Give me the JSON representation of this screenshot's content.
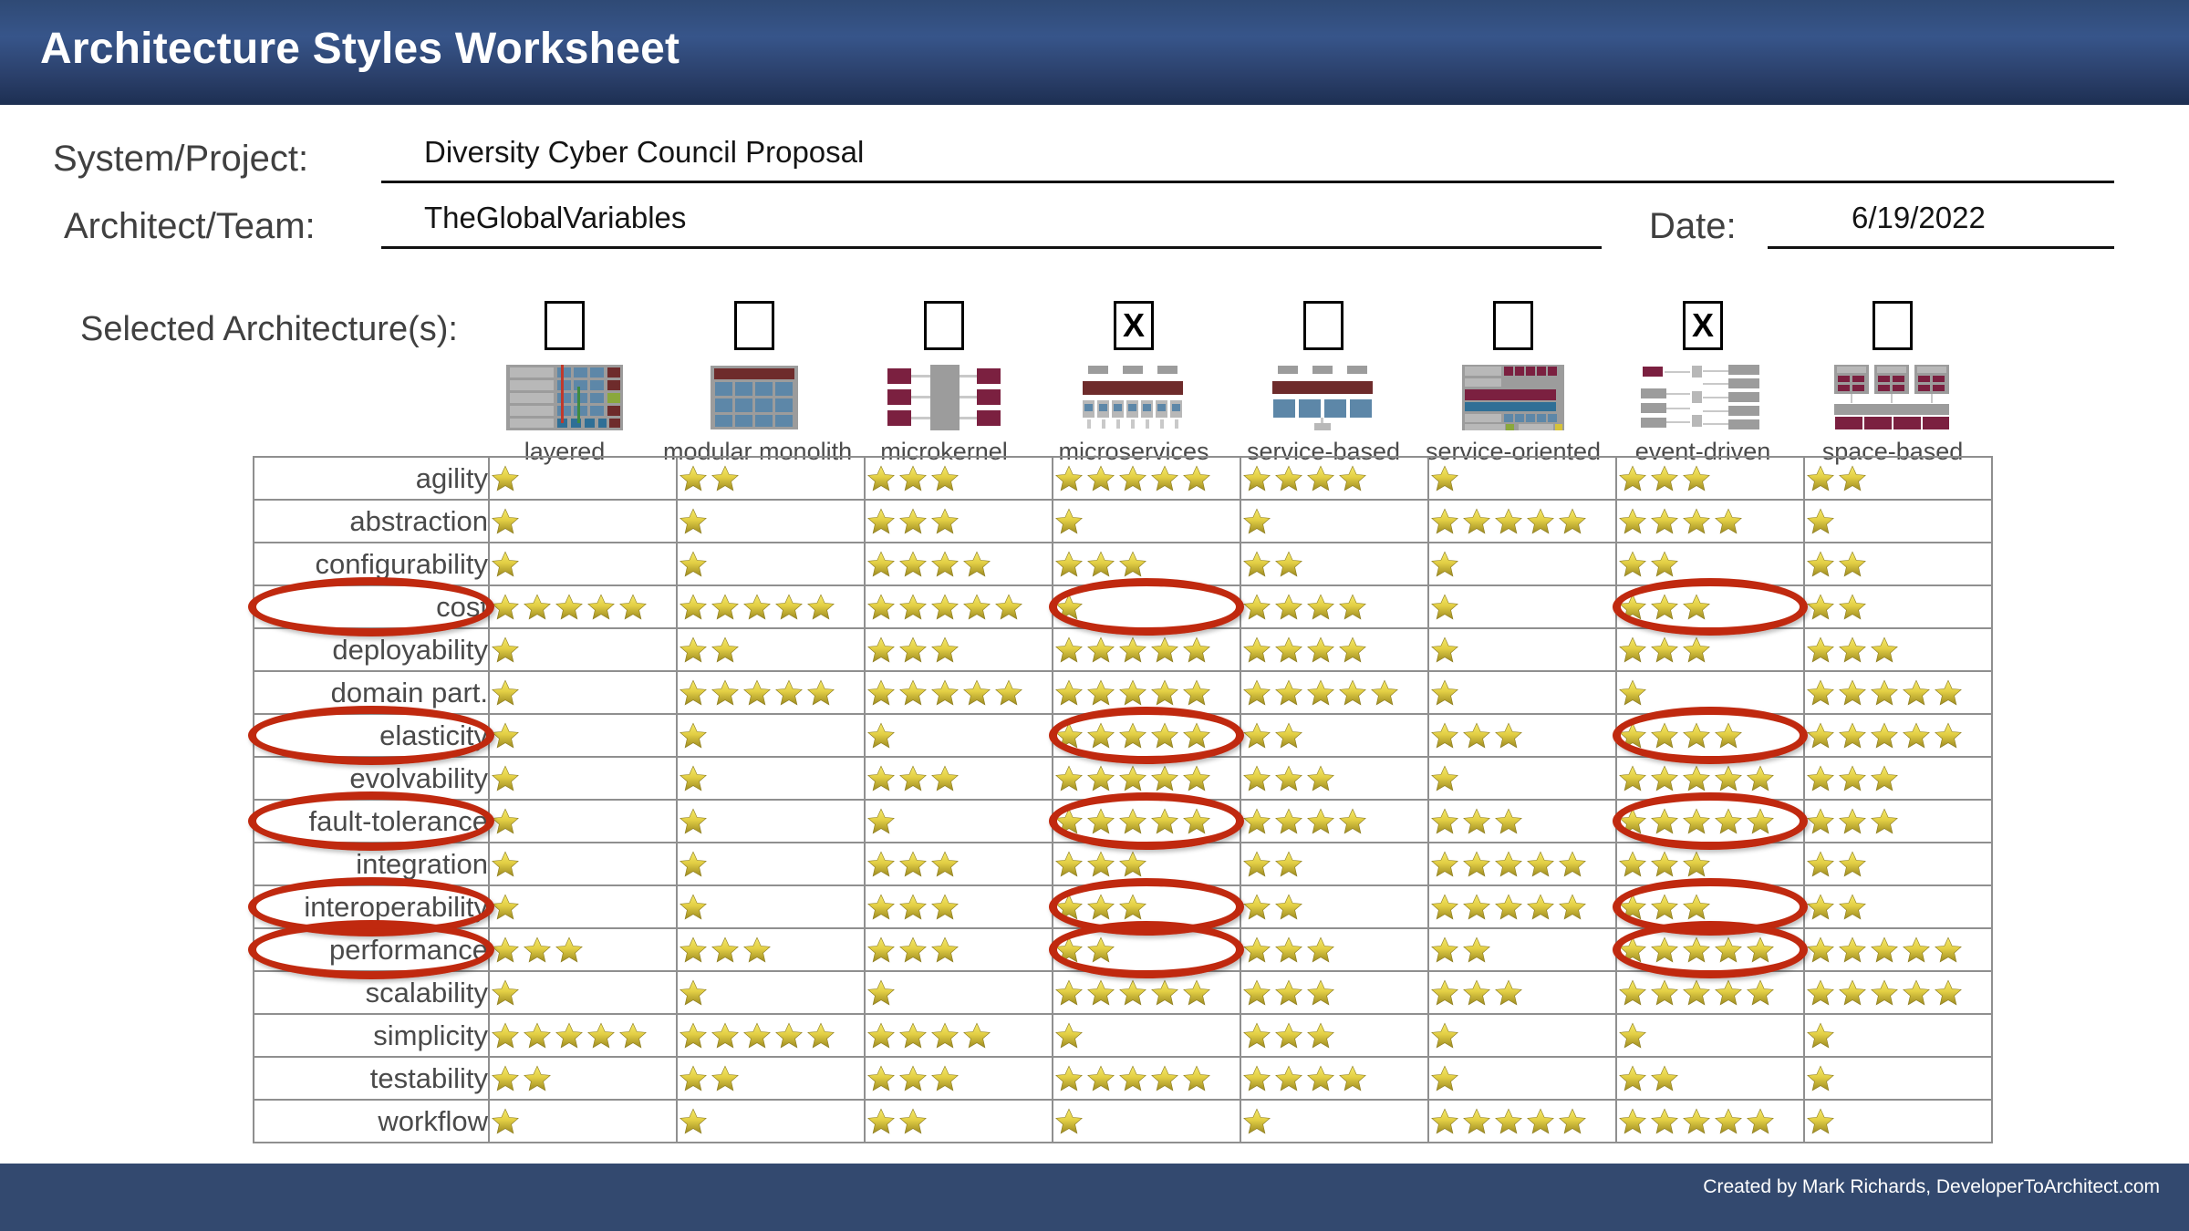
{
  "header": {
    "title": "Architecture Styles Worksheet"
  },
  "form": {
    "system_label": "System/Project:",
    "system_value": "Diversity Cyber Council Proposal",
    "architect_label": "Architect/Team:",
    "architect_value": "TheGlobalVariables",
    "date_label": "Date:",
    "date_value": "6/19/2022"
  },
  "selection": {
    "label": "Selected Architecture(s):",
    "checked_mark": "X"
  },
  "architectures": [
    {
      "name": "layered",
      "selected": false,
      "thumb": "layered-thumbnail"
    },
    {
      "name": "modular monolith",
      "selected": false,
      "thumb": "modular-monolith-thumbnail"
    },
    {
      "name": "microkernel",
      "selected": false,
      "thumb": "microkernel-thumbnail"
    },
    {
      "name": "microservices",
      "selected": true,
      "thumb": "microservices-thumbnail"
    },
    {
      "name": "service-based",
      "selected": false,
      "thumb": "service-based-thumbnail"
    },
    {
      "name": "service-oriented",
      "selected": false,
      "thumb": "service-oriented-thumbnail"
    },
    {
      "name": "event-driven",
      "selected": true,
      "thumb": "event-driven-thumbnail"
    },
    {
      "name": "space-based",
      "selected": false,
      "thumb": "space-based-thumbnail"
    }
  ],
  "chart_data": {
    "type": "heatmap",
    "title": "Architecture Styles Worksheet",
    "xlabel": "",
    "ylabel": "",
    "scale": {
      "min": 1,
      "max": 5,
      "unit": "stars"
    },
    "categories": [
      "layered",
      "modular monolith",
      "microkernel",
      "microservices",
      "service-based",
      "service-oriented",
      "event-driven",
      "space-based"
    ],
    "characteristics": [
      "agility",
      "abstraction",
      "configurability",
      "cost",
      "deployability",
      "domain part.",
      "elasticity",
      "evolvability",
      "fault-tolerance",
      "integration",
      "interoperability",
      "performance",
      "scalability",
      "simplicity",
      "testability",
      "workflow"
    ],
    "rows": [
      {
        "label": "agility",
        "values": [
          1,
          2,
          3,
          5,
          4,
          1,
          3,
          2
        ]
      },
      {
        "label": "abstraction",
        "values": [
          1,
          1,
          3,
          1,
          1,
          5,
          4,
          1
        ]
      },
      {
        "label": "configurability",
        "values": [
          1,
          1,
          4,
          3,
          2,
          1,
          2,
          2
        ]
      },
      {
        "label": "cost",
        "values": [
          5,
          5,
          5,
          1,
          4,
          1,
          3,
          2
        ]
      },
      {
        "label": "deployability",
        "values": [
          1,
          2,
          3,
          5,
          4,
          1,
          3,
          3
        ]
      },
      {
        "label": "domain part.",
        "values": [
          1,
          5,
          5,
          5,
          5,
          1,
          1,
          5
        ]
      },
      {
        "label": "elasticity",
        "values": [
          1,
          1,
          1,
          5,
          2,
          3,
          4,
          5
        ]
      },
      {
        "label": "evolvability",
        "values": [
          1,
          1,
          3,
          5,
          3,
          1,
          5,
          3
        ]
      },
      {
        "label": "fault-tolerance",
        "values": [
          1,
          1,
          1,
          5,
          4,
          3,
          5,
          3
        ]
      },
      {
        "label": "integration",
        "values": [
          1,
          1,
          3,
          3,
          2,
          5,
          3,
          2
        ]
      },
      {
        "label": "interoperability",
        "values": [
          1,
          1,
          3,
          3,
          2,
          5,
          3,
          2
        ]
      },
      {
        "label": "performance",
        "values": [
          3,
          3,
          3,
          2,
          3,
          2,
          5,
          5
        ]
      },
      {
        "label": "scalability",
        "values": [
          1,
          1,
          1,
          5,
          3,
          3,
          5,
          5
        ]
      },
      {
        "label": "simplicity",
        "values": [
          5,
          5,
          4,
          1,
          3,
          1,
          1,
          1
        ]
      },
      {
        "label": "testability",
        "values": [
          2,
          2,
          3,
          5,
          4,
          1,
          2,
          1
        ]
      },
      {
        "label": "workflow",
        "values": [
          1,
          1,
          2,
          1,
          1,
          5,
          5,
          1
        ]
      }
    ],
    "annotations": [
      {
        "type": "ellipse",
        "target": "row-label",
        "row": "cost"
      },
      {
        "type": "ellipse",
        "target": "row-label",
        "row": "elasticity"
      },
      {
        "type": "ellipse",
        "target": "row-label",
        "row": "fault-tolerance"
      },
      {
        "type": "ellipse",
        "target": "row-label",
        "row": "interoperability"
      },
      {
        "type": "ellipse",
        "target": "row-label",
        "row": "performance"
      },
      {
        "type": "ellipse",
        "target": "cell",
        "row": "cost",
        "column": "microservices"
      },
      {
        "type": "ellipse",
        "target": "cell",
        "row": "cost",
        "column": "event-driven"
      },
      {
        "type": "ellipse",
        "target": "cell",
        "row": "elasticity",
        "column": "microservices"
      },
      {
        "type": "ellipse",
        "target": "cell",
        "row": "elasticity",
        "column": "event-driven"
      },
      {
        "type": "ellipse",
        "target": "cell",
        "row": "fault-tolerance",
        "column": "microservices"
      },
      {
        "type": "ellipse",
        "target": "cell",
        "row": "fault-tolerance",
        "column": "event-driven"
      },
      {
        "type": "ellipse",
        "target": "cell",
        "row": "interoperability",
        "column": "microservices"
      },
      {
        "type": "ellipse",
        "target": "cell",
        "row": "interoperability",
        "column": "event-driven"
      },
      {
        "type": "ellipse",
        "target": "cell",
        "row": "performance",
        "column": "microservices"
      },
      {
        "type": "ellipse",
        "target": "cell",
        "row": "performance",
        "column": "event-driven"
      }
    ],
    "annotation_color": "#c0290f",
    "star_color": "#d9c33a"
  },
  "footer": {
    "credit": "Created by Mark Richards, DeveloperToArchitect.com"
  }
}
